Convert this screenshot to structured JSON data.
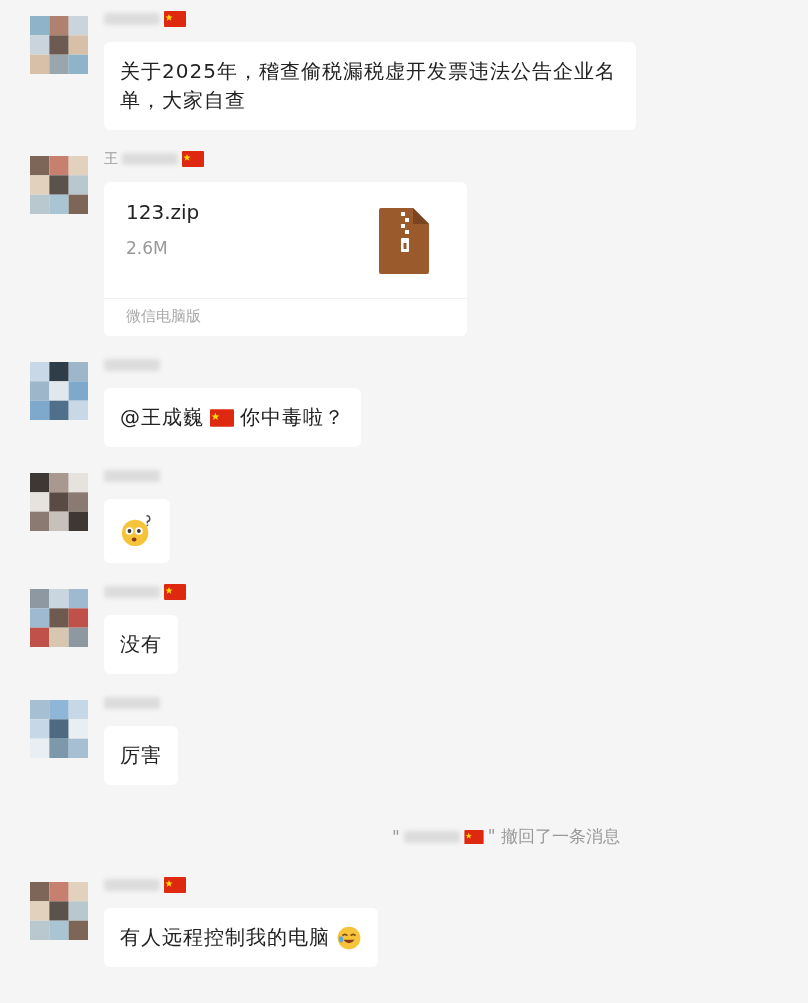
{
  "messages": [
    {
      "kind": "text",
      "sender": {
        "flag": true
      },
      "segments": [
        {
          "kind": "text",
          "text": "关于2025年，稽查偷税漏税虚开发票违法公告企业名单，大家自查"
        }
      ]
    },
    {
      "kind": "file",
      "sender": {
        "name": "王",
        "flag": true
      },
      "file": {
        "name": "123.zip",
        "size": "2.6M",
        "source": "微信电脑版"
      }
    },
    {
      "kind": "text",
      "sender": {
        "flag": false
      },
      "segments": [
        {
          "kind": "text",
          "text": "@王成巍"
        },
        {
          "kind": "flag"
        },
        {
          "kind": "text",
          "text": "你中毒啦？"
        }
      ]
    },
    {
      "kind": "emoji",
      "sender": {
        "flag": false
      }
    },
    {
      "kind": "text",
      "sender": {
        "flag": true
      },
      "segments": [
        {
          "kind": "text",
          "text": "没有"
        }
      ]
    },
    {
      "kind": "text",
      "sender": {
        "flag": false
      },
      "segments": [
        {
          "kind": "text",
          "text": "厉害"
        }
      ]
    },
    {
      "kind": "system",
      "segments": [
        {
          "kind": "text",
          "text": "\""
        },
        {
          "kind": "blur"
        },
        {
          "kind": "flag"
        },
        {
          "kind": "text",
          "text": "\" 撤回了一条消息"
        }
      ]
    },
    {
      "kind": "text",
      "sender": {
        "flag": true
      },
      "segments": [
        {
          "kind": "text",
          "text": "有人远程控制我的电脑"
        },
        {
          "kind": "laugh"
        }
      ]
    }
  ]
}
